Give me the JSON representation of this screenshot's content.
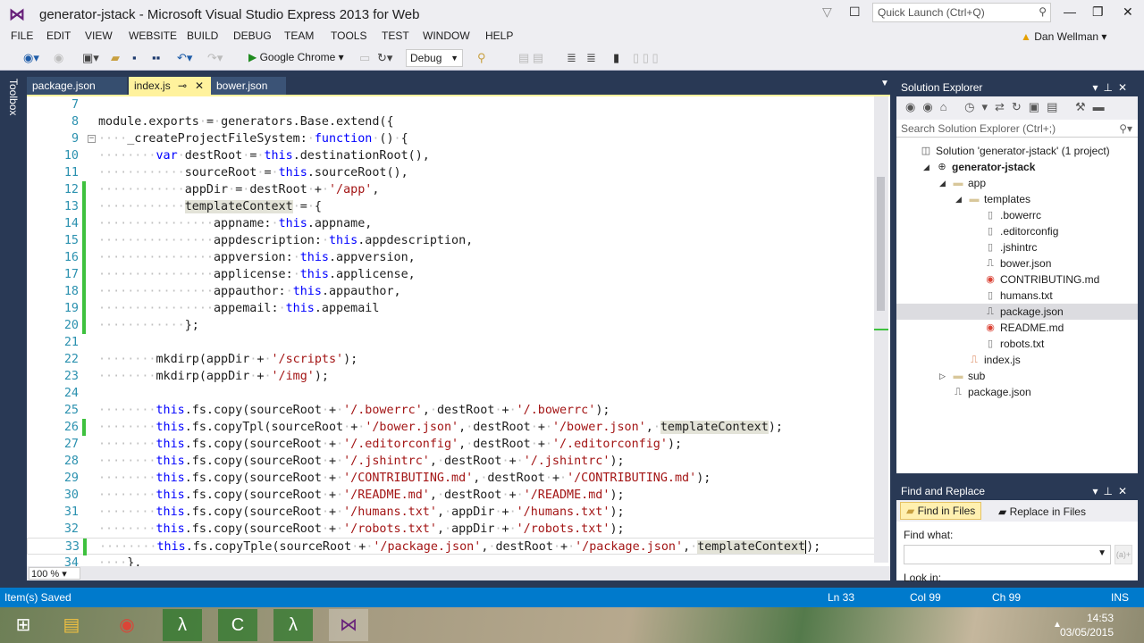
{
  "window": {
    "title": "generator-jstack - Microsoft Visual Studio Express 2013 for Web",
    "quick_launch_placeholder": "Quick Launch (Ctrl+Q)",
    "user": "Dan Wellman"
  },
  "menu": [
    "FILE",
    "EDIT",
    "VIEW",
    "WEBSITE",
    "BUILD",
    "DEBUG",
    "TEAM",
    "TOOLS",
    "TEST",
    "WINDOW",
    "HELP"
  ],
  "toolbar": {
    "run_target": "Google Chrome",
    "configuration": "Debug"
  },
  "toolbox_label": "Toolbox",
  "tabs": [
    {
      "label": "package.json"
    },
    {
      "label": "index.js",
      "active": true
    },
    {
      "label": "bower.json"
    }
  ],
  "editor": {
    "zoom": "100 %",
    "lines": [
      {
        "n": "7",
        "t": []
      },
      {
        "n": "8",
        "t": [
          [
            "p",
            "module.exports·=·generators.Base.extend({"
          ]
        ]
      },
      {
        "n": "9",
        "fold": true,
        "t": [
          [
            "p",
            "····_createProjectFileSystem:·"
          ],
          [
            "k",
            "function"
          ],
          [
            "p",
            "·()·{"
          ]
        ]
      },
      {
        "n": "10",
        "t": [
          [
            "p",
            "········"
          ],
          [
            "k",
            "var"
          ],
          [
            "p",
            "·destRoot·=·"
          ],
          [
            "k",
            "this"
          ],
          [
            "p",
            ".destinationRoot(),"
          ]
        ]
      },
      {
        "n": "11",
        "t": [
          [
            "p",
            "············sourceRoot·=·"
          ],
          [
            "k",
            "this"
          ],
          [
            "p",
            ".sourceRoot(),"
          ]
        ]
      },
      {
        "n": "12",
        "changed": true,
        "t": [
          [
            "p",
            "············appDir·=·destRoot·+·"
          ],
          [
            "s",
            "'/app'"
          ],
          [
            "p",
            ","
          ]
        ]
      },
      {
        "n": "13",
        "changed": true,
        "t": [
          [
            "p",
            "············"
          ],
          [
            "h",
            "templateContext"
          ],
          [
            "p",
            "·=·{"
          ]
        ]
      },
      {
        "n": "14",
        "changed": true,
        "t": [
          [
            "p",
            "················appname:·"
          ],
          [
            "k",
            "this"
          ],
          [
            "p",
            ".appname,"
          ]
        ]
      },
      {
        "n": "15",
        "changed": true,
        "t": [
          [
            "p",
            "················appdescription:·"
          ],
          [
            "k",
            "this"
          ],
          [
            "p",
            ".appdescription,"
          ]
        ]
      },
      {
        "n": "16",
        "changed": true,
        "t": [
          [
            "p",
            "················appversion:·"
          ],
          [
            "k",
            "this"
          ],
          [
            "p",
            ".appversion,"
          ]
        ]
      },
      {
        "n": "17",
        "changed": true,
        "t": [
          [
            "p",
            "················applicense:·"
          ],
          [
            "k",
            "this"
          ],
          [
            "p",
            ".applicense,"
          ]
        ]
      },
      {
        "n": "18",
        "changed": true,
        "t": [
          [
            "p",
            "················appauthor:·"
          ],
          [
            "k",
            "this"
          ],
          [
            "p",
            ".appauthor,"
          ]
        ]
      },
      {
        "n": "19",
        "changed": true,
        "t": [
          [
            "p",
            "················appemail:·"
          ],
          [
            "k",
            "this"
          ],
          [
            "p",
            ".appemail"
          ]
        ]
      },
      {
        "n": "20",
        "changed": true,
        "t": [
          [
            "p",
            "············};"
          ]
        ]
      },
      {
        "n": "21",
        "t": []
      },
      {
        "n": "22",
        "t": [
          [
            "p",
            "········mkdirp(appDir·+·"
          ],
          [
            "s",
            "'/scripts'"
          ],
          [
            "p",
            ");"
          ]
        ]
      },
      {
        "n": "23",
        "t": [
          [
            "p",
            "········mkdirp(appDir·+·"
          ],
          [
            "s",
            "'/img'"
          ],
          [
            "p",
            ");"
          ]
        ]
      },
      {
        "n": "24",
        "t": []
      },
      {
        "n": "25",
        "t": [
          [
            "p",
            "········"
          ],
          [
            "k",
            "this"
          ],
          [
            "p",
            ".fs.copy(sourceRoot·+·"
          ],
          [
            "s",
            "'/.bowerrc'"
          ],
          [
            "p",
            ",·destRoot·+·"
          ],
          [
            "s",
            "'/.bowerrc'"
          ],
          [
            "p",
            ");"
          ]
        ]
      },
      {
        "n": "26",
        "changed": true,
        "t": [
          [
            "p",
            "········"
          ],
          [
            "k",
            "this"
          ],
          [
            "p",
            ".fs.copyTpl(sourceRoot·+·"
          ],
          [
            "s",
            "'/bower.json'"
          ],
          [
            "p",
            ",·destRoot·+·"
          ],
          [
            "s",
            "'/bower.json'"
          ],
          [
            "p",
            ",·"
          ],
          [
            "h",
            "templateContext"
          ],
          [
            "p",
            ");"
          ]
        ]
      },
      {
        "n": "27",
        "t": [
          [
            "p",
            "········"
          ],
          [
            "k",
            "this"
          ],
          [
            "p",
            ".fs.copy(sourceRoot·+·"
          ],
          [
            "s",
            "'/.editorconfig'"
          ],
          [
            "p",
            ",·destRoot·+·"
          ],
          [
            "s",
            "'/.editorconfig'"
          ],
          [
            "p",
            ");"
          ]
        ]
      },
      {
        "n": "28",
        "t": [
          [
            "p",
            "········"
          ],
          [
            "k",
            "this"
          ],
          [
            "p",
            ".fs.copy(sourceRoot·+·"
          ],
          [
            "s",
            "'/.jshintrc'"
          ],
          [
            "p",
            ",·destRoot·+·"
          ],
          [
            "s",
            "'/.jshintrc'"
          ],
          [
            "p",
            ");"
          ]
        ]
      },
      {
        "n": "29",
        "t": [
          [
            "p",
            "········"
          ],
          [
            "k",
            "this"
          ],
          [
            "p",
            ".fs.copy(sourceRoot·+·"
          ],
          [
            "s",
            "'/CONTRIBUTING.md'"
          ],
          [
            "p",
            ",·destRoot·+·"
          ],
          [
            "s",
            "'/CONTRIBUTING.md'"
          ],
          [
            "p",
            ");"
          ]
        ]
      },
      {
        "n": "30",
        "t": [
          [
            "p",
            "········"
          ],
          [
            "k",
            "this"
          ],
          [
            "p",
            ".fs.copy(sourceRoot·+·"
          ],
          [
            "s",
            "'/README.md'"
          ],
          [
            "p",
            ",·destRoot·+·"
          ],
          [
            "s",
            "'/README.md'"
          ],
          [
            "p",
            ");"
          ]
        ]
      },
      {
        "n": "31",
        "t": [
          [
            "p",
            "········"
          ],
          [
            "k",
            "this"
          ],
          [
            "p",
            ".fs.copy(sourceRoot·+·"
          ],
          [
            "s",
            "'/humans.txt'"
          ],
          [
            "p",
            ",·appDir·+·"
          ],
          [
            "s",
            "'/humans.txt'"
          ],
          [
            "p",
            ");"
          ]
        ]
      },
      {
        "n": "32",
        "t": [
          [
            "p",
            "········"
          ],
          [
            "k",
            "this"
          ],
          [
            "p",
            ".fs.copy(sourceRoot·+·"
          ],
          [
            "s",
            "'/robots.txt'"
          ],
          [
            "p",
            ",·appDir·+·"
          ],
          [
            "s",
            "'/robots.txt'"
          ],
          [
            "p",
            ");"
          ]
        ]
      },
      {
        "n": "33",
        "changed": true,
        "current": true,
        "t": [
          [
            "p",
            "········"
          ],
          [
            "k",
            "this"
          ],
          [
            "p",
            ".fs.copyTple(sourceRoot·+·"
          ],
          [
            "s",
            "'/package.json'"
          ],
          [
            "p",
            ",·destRoot·+·"
          ],
          [
            "s",
            "'/package.json'"
          ],
          [
            "p",
            ",·"
          ],
          [
            "h",
            "templateContext"
          ],
          [
            "p",
            ");"
          ]
        ]
      },
      {
        "n": "34",
        "t": [
          [
            "p",
            "····},"
          ]
        ]
      }
    ]
  },
  "solution_explorer": {
    "title": "Solution Explorer",
    "search_placeholder": "Search Solution Explorer (Ctrl+;)",
    "items": [
      {
        "label": "Solution 'generator-jstack' (1 project)",
        "depth": 0,
        "icon": "solution-icon"
      },
      {
        "label": "generator-jstack",
        "depth": 1,
        "icon": "globe-icon",
        "expanded": true,
        "bold": true
      },
      {
        "label": "app",
        "depth": 2,
        "icon": "folder-icon",
        "expanded": true
      },
      {
        "label": "templates",
        "depth": 3,
        "icon": "folder-icon",
        "expanded": true
      },
      {
        "label": ".bowerrc",
        "depth": 4,
        "icon": "file-icon"
      },
      {
        "label": ".editorconfig",
        "depth": 4,
        "icon": "file-icon"
      },
      {
        "label": ".jshintrc",
        "depth": 4,
        "icon": "file-icon"
      },
      {
        "label": "bower.json",
        "depth": 4,
        "icon": "json-file-icon"
      },
      {
        "label": "CONTRIBUTING.md",
        "depth": 4,
        "icon": "chrome-icon"
      },
      {
        "label": "humans.txt",
        "depth": 4,
        "icon": "file-icon"
      },
      {
        "label": "package.json",
        "depth": 4,
        "icon": "json-file-icon",
        "selected": true
      },
      {
        "label": "README.md",
        "depth": 4,
        "icon": "chrome-icon"
      },
      {
        "label": "robots.txt",
        "depth": 4,
        "icon": "file-icon"
      },
      {
        "label": "index.js",
        "depth": 3,
        "icon": "js-file-icon"
      },
      {
        "label": "sub",
        "depth": 2,
        "icon": "folder-icon",
        "expanded": false
      },
      {
        "label": "package.json",
        "depth": 2,
        "icon": "json-file-icon"
      }
    ]
  },
  "find_replace": {
    "title": "Find and Replace",
    "find_in_files": "Find in Files",
    "replace_in_files": "Replace in Files",
    "find_what_label": "Find what:",
    "find_what_value": "",
    "regex_btn": "(a)+",
    "look_in_label": "Look in:"
  },
  "status": {
    "message": "Item(s) Saved",
    "ln": "Ln 33",
    "col": "Col 99",
    "ch": "Ch 99",
    "mode": "INS"
  },
  "taskbar": {
    "time": "14:53",
    "date": "03/05/2015"
  },
  "colors": {
    "accent": "#007acc",
    "frame": "#293955",
    "change_marker": "#3ec13e",
    "tab_active": "#fff29d"
  }
}
